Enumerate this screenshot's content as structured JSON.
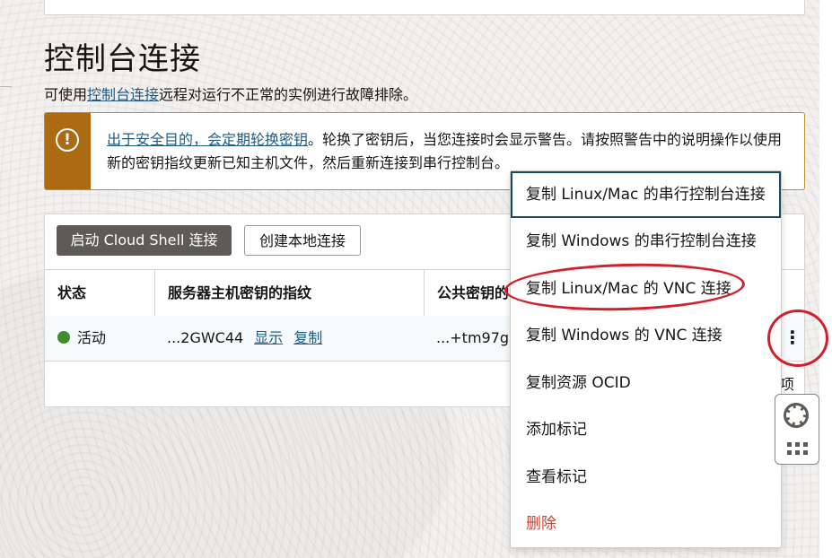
{
  "page": {
    "title": "控制台连接",
    "desc_prefix": "可使用",
    "desc_link": "控制台连接",
    "desc_suffix": "远程对运行不正常的实例进行故障排除。"
  },
  "warning": {
    "icon": "exclamation-circle-icon",
    "link": "出于安全目的，会定期轮换密钥",
    "text": "。轮换了密钥后，当您连接时会显示警告。请按照警告中的说明操作以使用新的密钥指纹更新已知主机文件，然后重新连接到串行控制台。"
  },
  "toolbar": {
    "primary": "启动 Cloud Shell 连接",
    "secondary": "创建本地连接"
  },
  "table": {
    "headers": [
      "状态",
      "服务器主机密钥的指纹",
      "公共密钥的"
    ],
    "row": {
      "status": "活动",
      "fingerprint": "...2GWC44",
      "show": "显示",
      "copy": "复制",
      "public_key": "...+tm97g"
    },
    "partial_text": "项"
  },
  "menu": {
    "items": [
      "复制 Linux/Mac 的串行控制台连接",
      "复制 Windows 的串行控制台连接",
      "复制 Linux/Mac 的 VNC 连接",
      "复制 Windows 的 VNC 连接",
      "复制资源 OCID",
      "添加标记",
      "查看标记",
      "删除"
    ]
  },
  "colors": {
    "warning": "#ac6a13",
    "link": "#1f5c83",
    "status_active": "#3e8e2e",
    "danger": "#c74634",
    "annotation": "#d41f2b"
  }
}
